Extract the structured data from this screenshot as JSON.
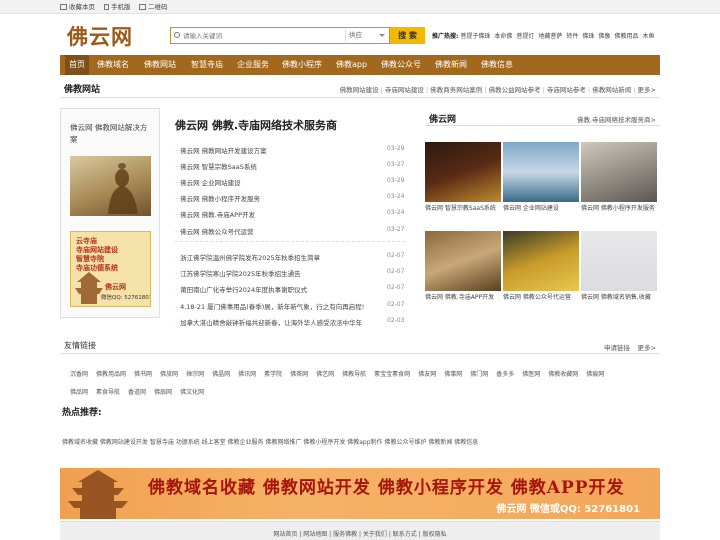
{
  "topbar": {
    "favorite": "收藏本页",
    "mobile": "手机版",
    "qrcode": "二维码"
  },
  "logo": "佛云网",
  "search": {
    "placeholder": "请输入关键词",
    "select": "供应",
    "button": "搜 索"
  },
  "hot": {
    "label": "推广热搜:",
    "items": [
      "菩提子佛珠",
      "本命佛",
      "菩提灯",
      "地藏菩萨",
      "转件",
      "佛珠",
      "佛像",
      "佛教用品",
      "木鱼"
    ]
  },
  "nav": [
    "首页",
    "佛教域名",
    "佛教网站",
    "智慧寺庙",
    "企业服务",
    "佛教小程序",
    "佛教app",
    "佛教公众号",
    "佛教新闻",
    "佛教信息"
  ],
  "section": {
    "title": "佛教网站",
    "links": [
      "佛教网站建设",
      "寺庙网站建设",
      "佛教商务网站案例",
      "佛教公益网站参考",
      "寺庙网站参考",
      "佛教网站新闻",
      "更多>"
    ]
  },
  "left": {
    "title": "佛云网 佛教网站解决方案",
    "banner_lines": [
      "云寺庙",
      "寺庙网站建设",
      "智慧寺院",
      "寺庙功德系统"
    ],
    "banner_brand": "佛云网",
    "banner_qq": "微信QQ: 52761801"
  },
  "center": {
    "title": "佛云网 佛教.寺庙网络技术服务商",
    "list1": [
      {
        "t": "佛云网 佛教网站开发建设方案",
        "d": "03-29"
      },
      {
        "t": "佛云网 智慧宗教SaaS系统",
        "d": "03-27"
      },
      {
        "t": "佛云网 企业网站建设",
        "d": "03-29"
      },
      {
        "t": "佛云网 佛教小程序开发服务",
        "d": "03-24"
      },
      {
        "t": "佛云网 佛教.寺庙APP开发",
        "d": "03-24"
      },
      {
        "t": "佛云网 佛教公众号代运营",
        "d": "03-27"
      }
    ],
    "list2": [
      {
        "t": "浙江佛学院温州佛学院发布2025年秋季招生简章",
        "d": "02-07"
      },
      {
        "t": "江苏佛学院寒山学院2025年秋季招生通告",
        "d": "02-07"
      },
      {
        "t": "莆田南山广化寺举行2024年度执事谢职仪式",
        "d": "02-07"
      },
      {
        "t": "4.18-21 厦门佛事用品(春季)展，新年新气象，行之有向再启程!",
        "d": "02-07"
      },
      {
        "t": "加拿大湛山精舍敲钟祈福共迎新春，让海外华人感受浓浓中华年",
        "d": "02-03"
      }
    ]
  },
  "right": {
    "title": "佛云网",
    "link": "佛教.寺庙网络技术服务商>",
    "items": [
      "佛云网 智慧宗教SaaS系统",
      "佛云网 企业网站建设",
      "佛云网 佛教小程序开发服务",
      "佛云网 佛教.寺庙APP开发",
      "佛云网 佛教公众号代运营",
      "佛云网 佛教域名销售,收藏"
    ]
  },
  "friends": {
    "title": "友情链接",
    "apply": "申请链接",
    "more": "更多>",
    "row1": [
      "沉香网",
      "佛教用品网",
      "佛书网",
      "佛旅网",
      "禅宗网",
      "佛晶网",
      "佛讯网",
      "素学院",
      "佛茶网",
      "佛艺网",
      "佛教导航",
      "素宝宝素食网",
      "佛友网",
      "佛事网",
      "佛门网",
      "香多多",
      "佛医网",
      "佛教收藏网",
      "佛痕网"
    ],
    "row2": [
      "佛品网",
      "素食导航",
      "香道网",
      "佛扇网",
      "佛文化网"
    ]
  },
  "hot_recommend": {
    "title": "热点推荐:",
    "text": "佛教域名收藏 佛教网站建设开发 智慧寺庙 功德系统 线上客堂 佛教企业服务 佛教网络推广 佛教小程序开发 佛教app制作 佛教公众号维护 佛教新闻 佛教信息"
  },
  "banner": {
    "text": "佛教域名收藏  佛教网站开发  佛教小程序开发  佛教APP开发",
    "brand": "佛云网 微信或QQ: 52761801"
  },
  "footer": {
    "links": "网站首页 | 网站地图 | 服务佛教 | 关于我们 | 联系方式 | 版权隐私"
  }
}
